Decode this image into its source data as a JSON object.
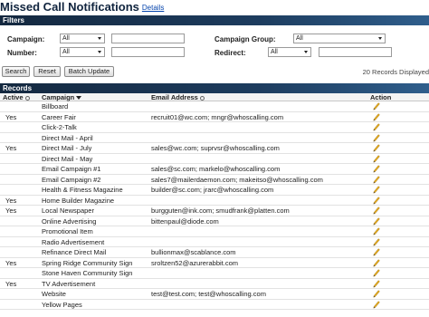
{
  "header": {
    "title": "Missed Call Notifications",
    "details_link": "Details"
  },
  "filters": {
    "section_label": "Filters",
    "campaign": {
      "label": "Campaign:",
      "select_value": "All",
      "text_value": ""
    },
    "number": {
      "label": "Number:",
      "select_value": "All",
      "text_value": ""
    },
    "campaign_group": {
      "label": "Campaign Group:",
      "select_value": "All"
    },
    "redirect": {
      "label": "Redirect:",
      "select_value": "All",
      "text_value": ""
    }
  },
  "toolbar": {
    "search_label": "Search",
    "reset_label": "Reset",
    "batch_update_label": "Batch Update",
    "record_count": "20 Records Displayed"
  },
  "records": {
    "section_label": "Records",
    "columns": {
      "active": "Active",
      "campaign": "Campaign",
      "email": "Email Address",
      "action": "Action"
    },
    "rows": [
      {
        "active": "",
        "campaign": "Billboard",
        "email": ""
      },
      {
        "active": "Yes",
        "campaign": "Career Fair",
        "email": "recruit01@wc.com; mngr@whoscalling.com"
      },
      {
        "active": "",
        "campaign": "Click-2-Talk",
        "email": ""
      },
      {
        "active": "",
        "campaign": "Direct Mail - April",
        "email": ""
      },
      {
        "active": "Yes",
        "campaign": "Direct Mail - July",
        "email": "sales@wc.com; suprvsr@whoscalling.com"
      },
      {
        "active": "",
        "campaign": "Direct Mail - May",
        "email": ""
      },
      {
        "active": "",
        "campaign": "Email Campaign #1",
        "email": "sales@sc.com; markelo@whoscalling.com"
      },
      {
        "active": "",
        "campaign": "Email Campaign #2",
        "email": "sales7@mailerdaemon.com; makeitso@whoscalling.com"
      },
      {
        "active": "",
        "campaign": "Health & Fitness Magazine",
        "email": "builder@sc.com; jrarc@whoscalling.com"
      },
      {
        "active": "Yes",
        "campaign": "Home Builder Magazine",
        "email": ""
      },
      {
        "active": "Yes",
        "campaign": "Local Newspaper",
        "email": "burgguten@ink.com; smudfrank@platten.com"
      },
      {
        "active": "",
        "campaign": "Online Advertising",
        "email": "bittenpaul@diode.com"
      },
      {
        "active": "",
        "campaign": "Promotional Item",
        "email": ""
      },
      {
        "active": "",
        "campaign": "Radio Advertisement",
        "email": ""
      },
      {
        "active": "",
        "campaign": "Refinance Direct Mail",
        "email": "bullionmax@scablance.com"
      },
      {
        "active": "Yes",
        "campaign": "Spring Ridge Community Sign",
        "email": "sroltzen52@azurerabbit.com"
      },
      {
        "active": "",
        "campaign": "Stone Haven Community Sign",
        "email": ""
      },
      {
        "active": "Yes",
        "campaign": "TV Advertisement",
        "email": ""
      },
      {
        "active": "",
        "campaign": "Website",
        "email": "test@test.com; test@whoscalling.com"
      },
      {
        "active": "",
        "campaign": "Yellow Pages",
        "email": ""
      }
    ]
  },
  "colors": {
    "header_bar": "#1d3c5e",
    "title": "#10243e",
    "link": "#0645ad",
    "edit_icon": "#e8b020"
  },
  "icons": {
    "edit": "pencil-icon",
    "sort": "sort-icon"
  }
}
